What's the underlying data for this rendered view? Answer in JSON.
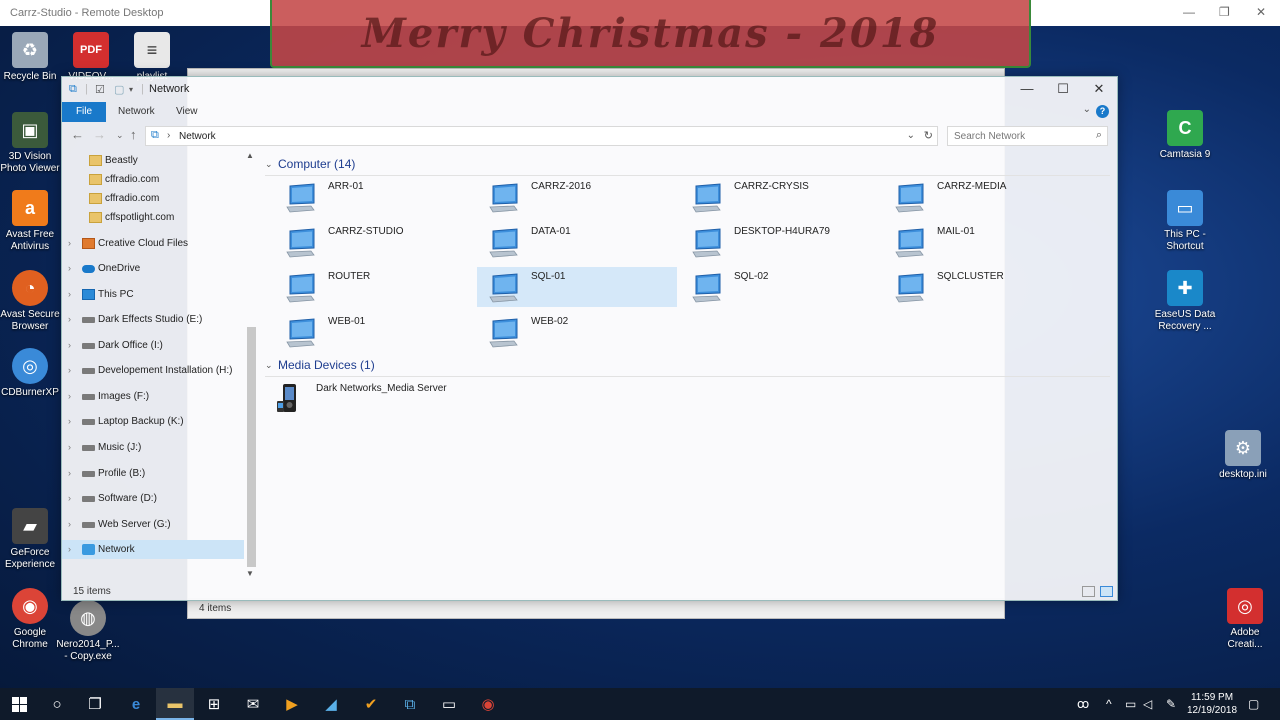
{
  "remote_desktop": {
    "title": "Carrz-Studio - Remote Desktop"
  },
  "banner": {
    "text": "Merry Christmas - 2018"
  },
  "desktop_icons_left": [
    {
      "label": "Recycle Bin",
      "icon": "recycle-bin-icon",
      "color": "#9aa8b8"
    },
    {
      "label": "3D Vision Photo Viewer",
      "icon": "3d-vision-icon",
      "color": "#3b5a3b"
    },
    {
      "label": "Avast Free Antivirus",
      "icon": "avast-icon",
      "color": "#f07b1b"
    },
    {
      "label": "Avast Secure Browser",
      "icon": "avast-browser-icon",
      "color": "#e06020"
    },
    {
      "label": "CDBurnerXP",
      "icon": "cd-icon",
      "color": "#3a8ad8"
    },
    {
      "label": "GeForce Experience",
      "icon": "geforce-icon",
      "color": "#444444"
    },
    {
      "label": "Google Chrome",
      "icon": "chrome-icon",
      "color": "#db4437"
    },
    {
      "label": "Nero2014_P... - Copy.exe",
      "icon": "nero-icon",
      "color": "#888888"
    }
  ],
  "desktop_icons_top": [
    {
      "label": "VIDEOV...",
      "icon": "pdf-icon",
      "glyph": "PDF",
      "color": "#d32f2f"
    },
    {
      "label": "playlist",
      "icon": "playlist-icon",
      "glyph": "≡",
      "color": "#e8e8e8"
    }
  ],
  "desktop_icons_right": [
    {
      "label": "Camtasia 9",
      "icon": "camtasia-icon",
      "glyph": "C",
      "color": "#2fa84f"
    },
    {
      "label": "This PC - Shortcut",
      "icon": "this-pc-icon",
      "glyph": "▭",
      "color": "#3a8ad8"
    },
    {
      "label": "EaseUS Data Recovery ...",
      "icon": "easeus-icon",
      "glyph": "✚",
      "color": "#1a88c9"
    },
    {
      "label": "desktop.ini",
      "icon": "ini-file-icon",
      "glyph": "⚙",
      "color": "#8aa0b8"
    },
    {
      "label": "Adobe Creati...",
      "icon": "adobe-cc-icon",
      "glyph": "◎",
      "color": "#d32f2f"
    }
  ],
  "bg_window": {
    "status": "4 items"
  },
  "window": {
    "title": "Network",
    "tabs": {
      "file": "File",
      "network": "Network",
      "view": "View"
    },
    "address": "Network",
    "search_placeholder": "Search Network",
    "status": "15 items"
  },
  "nav": [
    {
      "label": "Beastly",
      "type": "folder",
      "expandable": false,
      "indent": 1,
      "selected": false
    },
    {
      "label": "cffradio.com",
      "type": "folder",
      "expandable": false,
      "indent": 1,
      "selected": false
    },
    {
      "label": "cffradio.com",
      "type": "folder",
      "expandable": false,
      "indent": 1,
      "selected": false
    },
    {
      "label": "cffspotlight.com",
      "type": "folder",
      "expandable": false,
      "indent": 1,
      "selected": false
    },
    {
      "label": "Creative Cloud Files",
      "type": "cc",
      "expandable": true,
      "indent": 0,
      "selected": false
    },
    {
      "label": "OneDrive",
      "type": "cloud",
      "expandable": true,
      "indent": 0,
      "selected": false
    },
    {
      "label": "This PC",
      "type": "pc",
      "expandable": true,
      "indent": 0,
      "selected": false
    },
    {
      "label": "Dark Effects Studio (E:)",
      "type": "drive",
      "expandable": true,
      "indent": 0,
      "selected": false
    },
    {
      "label": "Dark Office (I:)",
      "type": "drive",
      "expandable": true,
      "indent": 0,
      "selected": false
    },
    {
      "label": "Developement Installation (H:)",
      "type": "drive",
      "expandable": true,
      "indent": 0,
      "selected": false
    },
    {
      "label": "Images (F:)",
      "type": "drive",
      "expandable": true,
      "indent": 0,
      "selected": false
    },
    {
      "label": "Laptop Backup (K:)",
      "type": "drive",
      "expandable": true,
      "indent": 0,
      "selected": false
    },
    {
      "label": "Music (J:)",
      "type": "drive",
      "expandable": true,
      "indent": 0,
      "selected": false
    },
    {
      "label": "Profile (B:)",
      "type": "drive",
      "expandable": true,
      "indent": 0,
      "selected": false
    },
    {
      "label": "Software (D:)",
      "type": "drive",
      "expandable": true,
      "indent": 0,
      "selected": false
    },
    {
      "label": "Web Server (G:)",
      "type": "drive",
      "expandable": true,
      "indent": 0,
      "selected": false
    },
    {
      "label": "Network",
      "type": "net",
      "expandable": true,
      "indent": 0,
      "selected": true
    }
  ],
  "groups": {
    "computer": {
      "title": "Computer (14)",
      "items": [
        {
          "name": "ARR-01",
          "selected": false
        },
        {
          "name": "CARRZ-2016",
          "selected": false
        },
        {
          "name": "CARRZ-CRYSIS",
          "selected": false
        },
        {
          "name": "CARRZ-MEDIA",
          "selected": false
        },
        {
          "name": "CARRZ-STUDIO",
          "selected": false
        },
        {
          "name": "DATA-01",
          "selected": false
        },
        {
          "name": "DESKTOP-H4URA79",
          "selected": false
        },
        {
          "name": "MAIL-01",
          "selected": false
        },
        {
          "name": "ROUTER",
          "selected": false
        },
        {
          "name": "SQL-01",
          "selected": true
        },
        {
          "name": "SQL-02",
          "selected": false
        },
        {
          "name": "SQLCLUSTER",
          "selected": false
        },
        {
          "name": "WEB-01",
          "selected": false
        },
        {
          "name": "WEB-02",
          "selected": false
        }
      ]
    },
    "media": {
      "title": "Media Devices (1)",
      "items": [
        {
          "name": "Dark Networks_Media Server"
        }
      ]
    }
  },
  "clock": {
    "time": "11:59 PM",
    "date": "12/19/2018"
  },
  "colors": {
    "accent": "#1979ca",
    "selection": "#cce4f7",
    "group_header": "#1e3d8f"
  }
}
